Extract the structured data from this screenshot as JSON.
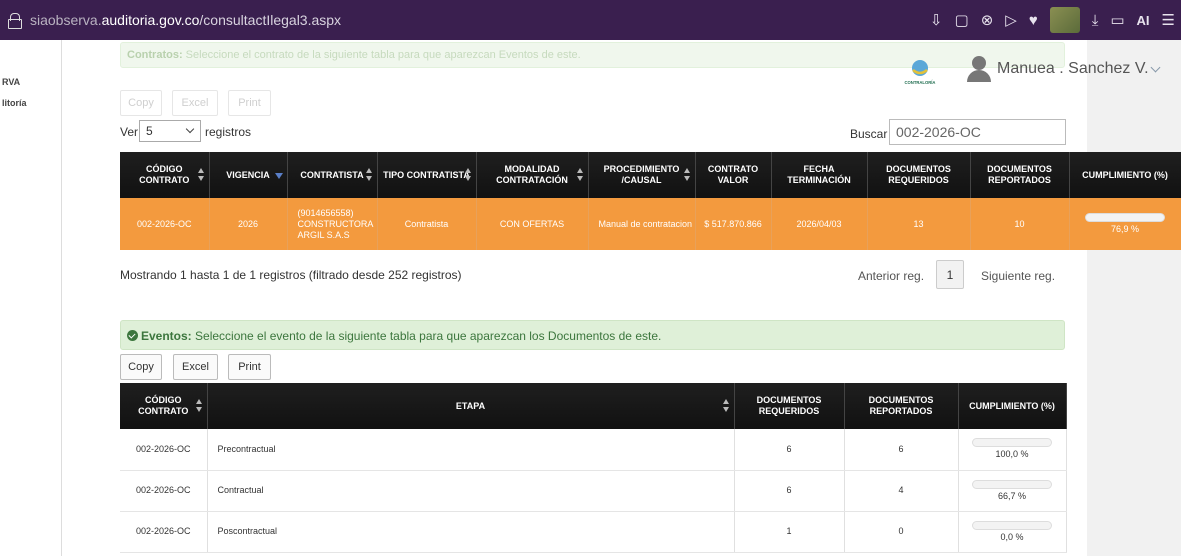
{
  "browser": {
    "url_prefix": "siaobserva.",
    "url_domain": "auditoria.gov.co",
    "url_path": "/consultactIlegal3.aspx",
    "ai_label": "AI"
  },
  "left_strip": {
    "line1": "RVA",
    "line2": "litoría"
  },
  "contratos_alert": {
    "strong": "Contratos:",
    "text": " Seleccione el contrato de la siguiente tabla para que aparezcan Eventos de este."
  },
  "header": {
    "logo_text": "CONTRALORÍA",
    "user_name": "Manuea . Sanchez V."
  },
  "buttons_top": {
    "copy": "Copy",
    "excel": "Excel",
    "print": "Print"
  },
  "length_control": {
    "ver": "Ver",
    "value": "5",
    "registros": "registros"
  },
  "search": {
    "label": "Buscar",
    "value": "002-2026-OC"
  },
  "contracts_table": {
    "headers": [
      "CÓDIGO CONTRATO",
      "VIGENCIA",
      "CONTRATISTA",
      "TIPO CONTRATISTA",
      "MODALIDAD CONTRATACIÓN",
      "PROCEDIMIENTO /CAUSAL",
      "CONTRATO VALOR",
      "FECHA TERMINACIÓN",
      "DOCUMENTOS REQUERIDOS",
      "DOCUMENTOS REPORTADOS",
      "CUMPLIMIENTO (%)"
    ],
    "row": {
      "codigo": "002-2026-OC",
      "vigencia": "2026",
      "contratista": "(9014656558) CONSTRUCTORA ARGIL S.A.S",
      "tipo": "Contratista",
      "modalidad": "CON OFERTAS",
      "procedimiento": "Manual de contratacion",
      "valor": "$ 517.870.866",
      "fecha": "2026/04/03",
      "requeridos": "13",
      "reportados": "10",
      "cumplimiento_label": "76,9 %",
      "cumplimiento": 76.9
    }
  },
  "pagination": {
    "info": "Mostrando 1 hasta 1 de 1 registros (filtrado desde 252 registros)",
    "prev": "Anterior reg.",
    "page": "1",
    "next": "Siguiente reg."
  },
  "eventos_alert": {
    "strong": "Eventos:",
    "text": " Seleccione el evento de la siguiente tabla para que aparezcan los Documentos de este."
  },
  "buttons_events": {
    "copy": "Copy",
    "excel": "Excel",
    "print": "Print"
  },
  "events_table": {
    "headers": [
      "CÓDIGO CONTRATO",
      "ETAPA",
      "DOCUMENTOS REQUERIDOS",
      "DOCUMENTOS REPORTADOS",
      "CUMPLIMIENTO (%)"
    ],
    "rows": [
      {
        "codigo": "002-2026-OC",
        "etapa": "Precontractual",
        "requeridos": "6",
        "reportados": "6",
        "cumplimiento_label": "100,0 %",
        "cumplimiento": 100,
        "color": "#4aa84a"
      },
      {
        "codigo": "002-2026-OC",
        "etapa": "Contractual",
        "requeridos": "6",
        "reportados": "4",
        "cumplimiento_label": "66,7 %",
        "cumplimiento": 66.7,
        "color": "#d64545"
      },
      {
        "codigo": "002-2026-OC",
        "etapa": "Poscontractual",
        "requeridos": "1",
        "reportados": "0",
        "cumplimiento_label": "0,0 %",
        "cumplimiento": 0,
        "color": "#d64545"
      }
    ]
  },
  "colors": {
    "row_highlight": "#f39a3e",
    "header_bg": "#1a1a1a",
    "browser_bar": "#3a1f4f",
    "success_bg": "#dff0d8"
  }
}
